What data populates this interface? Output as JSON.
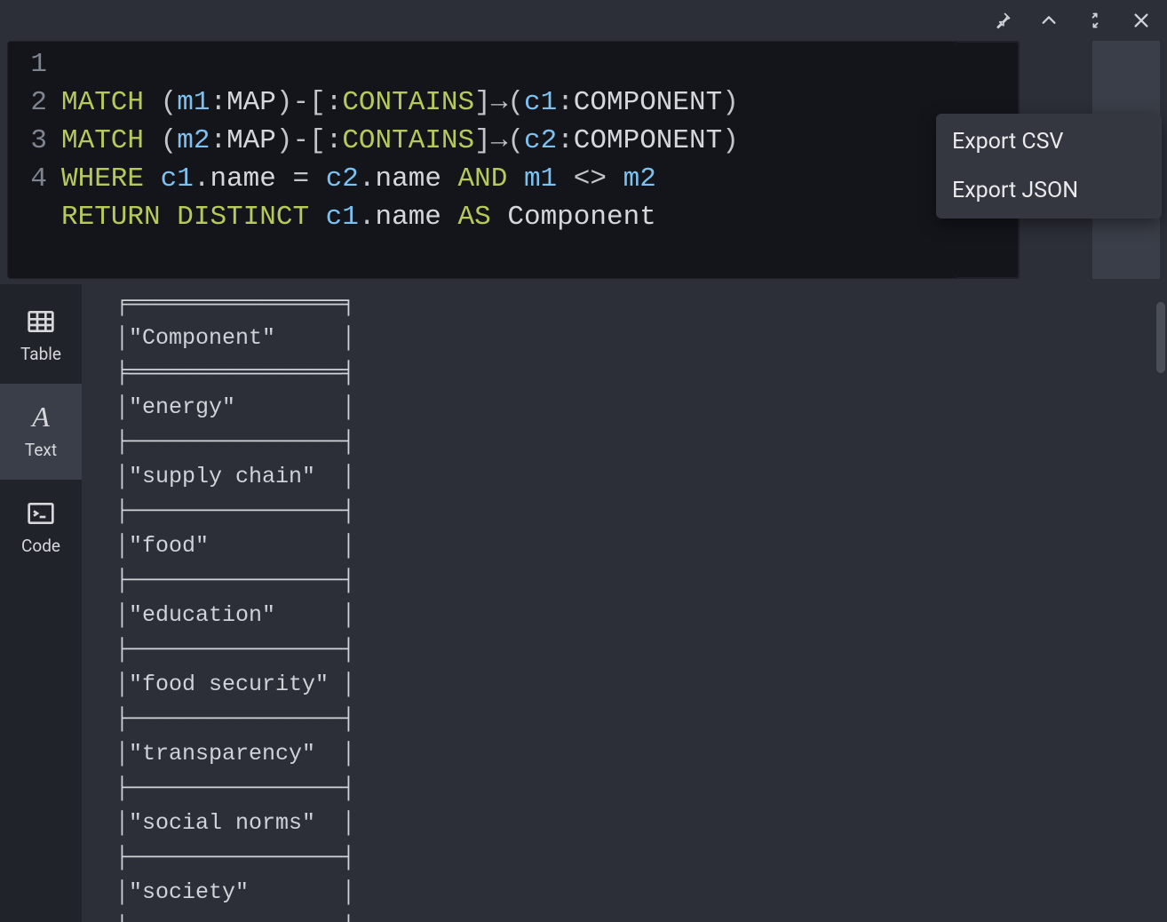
{
  "top_icons": {
    "pin": "pin-icon",
    "up": "chevron-up-icon",
    "collapse": "collapse-icon",
    "close": "close-icon"
  },
  "editor": {
    "lines": [
      1,
      2,
      3,
      4
    ],
    "query_lines": {
      "l1": {
        "match": "MATCH",
        "open": " (",
        "var": "m1",
        "colon": ":",
        "lbl": "MAP",
        "close": ")",
        "dash": "-[",
        "colon2": ":",
        "rel": "CONTAINS",
        "close2": "]",
        "arrow": "→",
        "open2": "(",
        "var2": "c1",
        "colon3": ":",
        "lbl2": "COMPONENT",
        "close3": ")"
      },
      "l2": {
        "match": "MATCH",
        "open": " (",
        "var": "m2",
        "colon": ":",
        "lbl": "MAP",
        "close": ")",
        "dash": "-[",
        "colon2": ":",
        "rel": "CONTAINS",
        "close2": "]",
        "arrow": "→",
        "open2": "(",
        "var2": "c2",
        "colon3": ":",
        "lbl2": "COMPONENT",
        "close3": ")"
      },
      "l3": {
        "where": "WHERE",
        "sp": " ",
        "c1": "c1",
        "dot": ".",
        "name": "name",
        "eq": " = ",
        "c2": "c2",
        "dot2": ".",
        "name2": "name",
        "and": " AND ",
        "m1": "m1",
        "neq": " <> ",
        "m2": "m2"
      },
      "l4": {
        "ret": "RETURN",
        "sp": " ",
        "dist": "DISTINCT",
        "sp2": " ",
        "c1": "c1",
        "dot": ".",
        "name": "name",
        "sp3": " ",
        "as": "AS",
        "sp4": " ",
        "col": "Component"
      }
    }
  },
  "right_actions": {
    "run": "run-button",
    "star": "star-icon",
    "download": "download-icon"
  },
  "export_menu": {
    "csv": "Export CSV",
    "json": "Export JSON"
  },
  "side_tabs": {
    "table": "Table",
    "text": "Text",
    "code": "Code"
  },
  "result": {
    "header": "Component",
    "rows": [
      "energy",
      "supply chain",
      "food",
      "education",
      "food security",
      "transparency",
      "social norms",
      "society"
    ]
  }
}
